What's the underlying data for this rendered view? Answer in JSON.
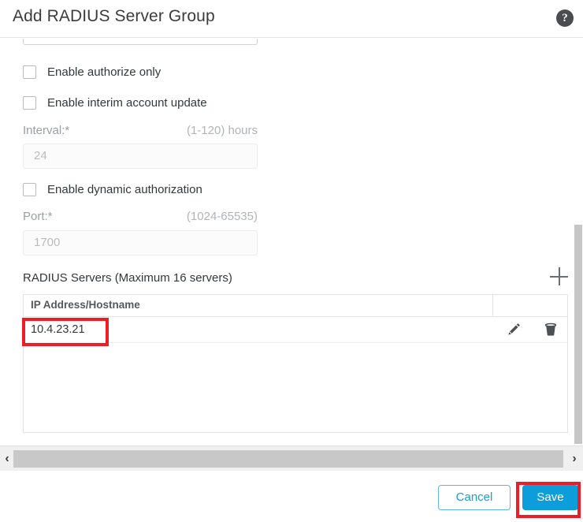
{
  "dialog": {
    "title": "Add RADIUS Server Group",
    "help_icon": "help-circle-icon"
  },
  "form": {
    "checkboxes": [
      {
        "label": "Enable authorize only",
        "checked": false
      },
      {
        "label": "Enable interim account update",
        "checked": false
      },
      {
        "label": "Enable dynamic authorization",
        "checked": false
      }
    ],
    "interval": {
      "label": "Interval:*",
      "hint": "(1-120) hours",
      "value": "",
      "placeholder": "24"
    },
    "port": {
      "label": "Port:*",
      "hint": "(1024-65535)",
      "value": "",
      "placeholder": "1700"
    }
  },
  "servers_section": {
    "title": "RADIUS Servers (Maximum 16 servers)",
    "add_icon": "plus-icon",
    "columns": [
      "IP Address/Hostname"
    ],
    "rows": [
      {
        "ip": "10.4.23.21",
        "edit_icon": "pencil-icon",
        "delete_icon": "trash-icon"
      }
    ]
  },
  "scrollbars": {
    "horizontal_left_arrow": "‹",
    "horizontal_right_arrow": "›"
  },
  "footer": {
    "cancel_label": "Cancel",
    "save_label": "Save"
  },
  "colors": {
    "accent_blue": "#0d9ddb",
    "annotation_red": "#ee1c25",
    "header_text": "#3c3c3c",
    "disabled_text": "#b8bcbf"
  }
}
